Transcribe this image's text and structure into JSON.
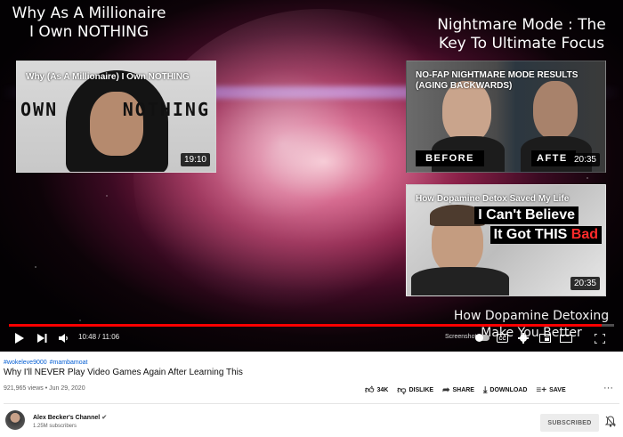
{
  "player": {
    "overlay_top_left": [
      "Why As A Millionaire",
      "I Own NOTHING"
    ],
    "overlay_top_right": [
      "Nightmare Mode : The",
      "Key To Ultimate Focus"
    ],
    "overlay_bottom_right": [
      "How Dopamine Detoxing",
      "Make You Better"
    ],
    "end_cards": [
      {
        "title": "Why (As A Millionaire) I Own NOTHING",
        "duration": "19:10",
        "word_left": "OWN",
        "word_right": "NOTHING"
      },
      {
        "title": "NO-FAP NIGHTMARE MODE RESULTS (AGING BACKWARDS)",
        "duration": "20:35",
        "label_before": "BEFORE",
        "label_after": "AFTE"
      },
      {
        "title": "How Dopamine Detox Saved My Life",
        "duration": "20:35",
        "line1": "I Can't Believe",
        "line2": "It Got THIS",
        "line2_red": "Bad"
      }
    ],
    "progress_fraction": 0.98,
    "time": "10:48 / 11:06",
    "screenshot_label": "Screenshot",
    "icons": [
      "play-icon",
      "next-icon",
      "volume-icon",
      "autoplay-toggle",
      "subtitles-icon",
      "settings-icon",
      "miniplayer-icon",
      "theater-icon",
      "fullscreen-icon"
    ]
  },
  "video": {
    "hashtags": [
      "#wokeleve9000",
      "#mambamoat"
    ],
    "title": "Why I'll NEVER Play Video Games Again After Learning This",
    "views": "921,965 views",
    "date": "Jun 29, 2020",
    "likes": "34K",
    "dislike_label": "DISLIKE",
    "share_label": "SHARE",
    "download_label": "DOWNLOAD",
    "save_label": "SAVE",
    "more_label": "···"
  },
  "channel": {
    "name": "Alex Becker's Channel",
    "verified_mark": "✔",
    "subscribers": "1.25M subscribers",
    "subscribed_label": "SUBSCRIBED"
  },
  "colors": {
    "progress": "#ff0000",
    "link": "#065fd4",
    "bad": "#ff2b2b"
  }
}
